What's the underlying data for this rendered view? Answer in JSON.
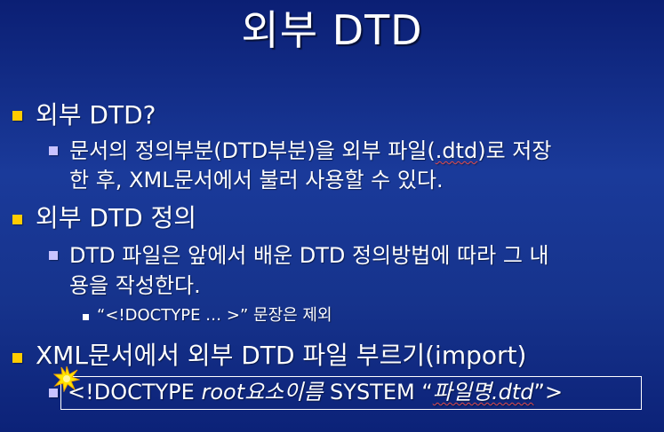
{
  "title": "외부 DTD",
  "items": [
    {
      "heading": "외부 DTD?",
      "text_lines": [
        {
          "pre": "문서의 정의부분(DTD부분)을 외부 파일(",
          "mark": ".dtd",
          "post": ")로 저장"
        },
        {
          "pre": "한 후, XML문서에서 불러 사용할 수 있다.",
          "mark": "",
          "post": ""
        }
      ]
    },
    {
      "heading": "외부 DTD 정의",
      "text_lines": [
        "DTD 파일은 앞에서 배운 DTD 정의방법에 따라 그 내",
        "용을 작성한다."
      ],
      "sub_note": "“<!DOCTYPE … >” 문장은 제외"
    },
    {
      "heading": "XML문서에서 외부 DTD 파일 부르기(import)",
      "doctype": {
        "prefix": "<!DOCTYPE ",
        "root": "root요소이름",
        "middle": " SYSTEM “",
        "file": "파일명.dtd",
        "suffix": "”>"
      }
    }
  ],
  "colors": {
    "background": "#16338c",
    "text": "#ffffff",
    "bullet_level1": "#ffcc00",
    "bullet_level2": "#c9c3ff",
    "spell_underline": "#e24b4b"
  },
  "icons": {
    "bullet_level1": "square",
    "bullet_level2": "square",
    "bullet_level3": "square",
    "animation_marker": "starburst-icon"
  }
}
